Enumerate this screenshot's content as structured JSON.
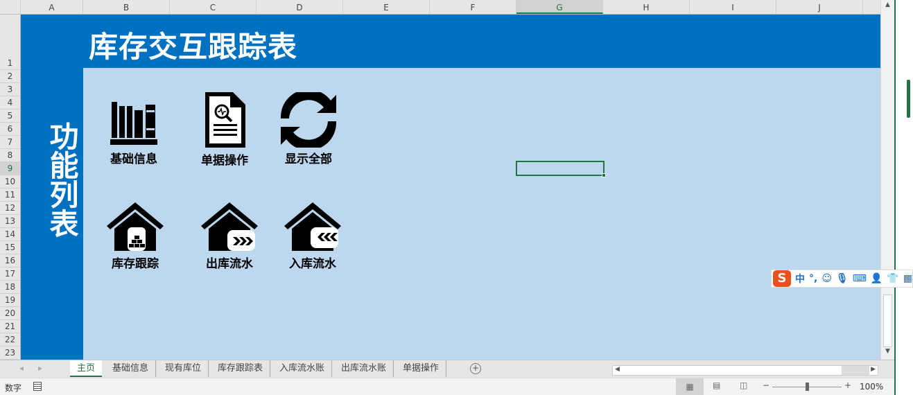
{
  "columns": [
    "A",
    "B",
    "C",
    "D",
    "E",
    "F",
    "G",
    "H",
    "I",
    "J"
  ],
  "rows": [
    "1",
    "2",
    "3",
    "4",
    "5",
    "6",
    "7",
    "8",
    "9",
    "10",
    "11",
    "12",
    "13",
    "14",
    "15",
    "16",
    "17",
    "18",
    "19",
    "20",
    "21",
    "22",
    "23"
  ],
  "selected_column": "G",
  "selected_row": "9",
  "title": "库存交互跟踪表",
  "side_title": "功能列表",
  "tiles": [
    {
      "label": "基础信息",
      "icon": "books-icon"
    },
    {
      "label": "单据操作",
      "icon": "document-search-icon"
    },
    {
      "label": "显示全部",
      "icon": "refresh-icon"
    },
    {
      "label": "库存跟踪",
      "icon": "house-stock-icon"
    },
    {
      "label": "出库流水",
      "icon": "house-out-icon"
    },
    {
      "label": "入库流水",
      "icon": "house-in-icon"
    }
  ],
  "sheet_tabs": [
    "主页",
    "基础信息",
    "现有库位",
    "库存跟踪表",
    "入库流水账",
    "出库流水账",
    "单据操作"
  ],
  "active_tab": "主页",
  "status": {
    "mode": "数字",
    "zoom": "100%"
  },
  "ime": {
    "mode": "中",
    "punct": "°,"
  },
  "colors": {
    "banner": "#0070C0",
    "sheet": "#BDD7EE",
    "accent": "#217346"
  }
}
